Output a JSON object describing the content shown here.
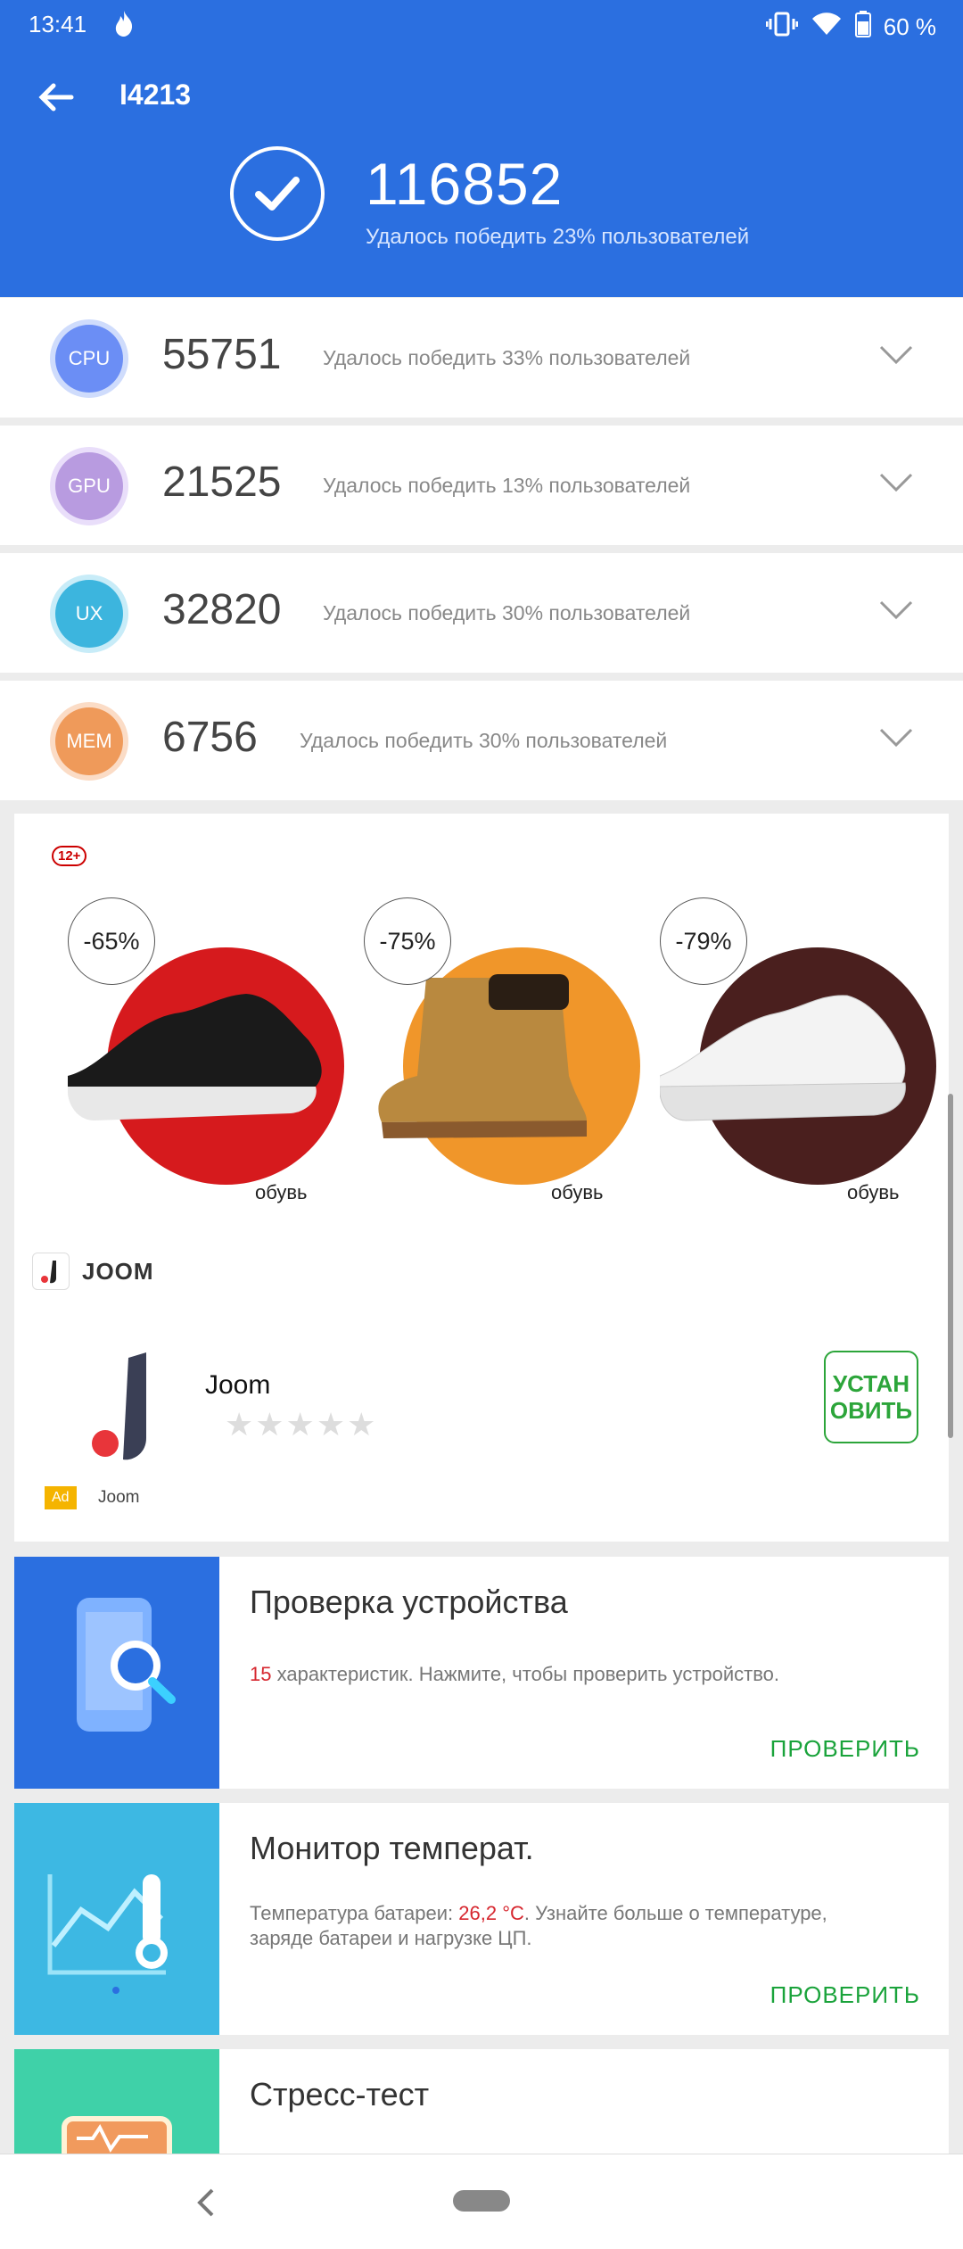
{
  "status": {
    "time": "13:41",
    "battery": "60 %"
  },
  "header": {
    "title": "I4213",
    "total_score": "116852",
    "total_beat": "Удалось победить 23% пользователей"
  },
  "results": [
    {
      "label": "CPU",
      "score": "55751",
      "beat": "Удалось победить 33% пользователей",
      "color": "#6b8ef5"
    },
    {
      "label": "GPU",
      "score": "21525",
      "beat": "Удалось победить 13% пользователей",
      "color": "#b89be0"
    },
    {
      "label": "UX",
      "score": "32820",
      "beat": "Удалось победить 30% пользователей",
      "color": "#3cb5de"
    },
    {
      "label": "MEM",
      "score": "6756",
      "beat": "Удалось победить 30% пользователей",
      "color": "#ef9a5a"
    }
  ],
  "ad": {
    "age_rating": "12+",
    "products": [
      {
        "discount": "-65%",
        "label": "обувь",
        "color": "#d61a1d"
      },
      {
        "discount": "-75%",
        "label": "обувь",
        "color": "#f0962a"
      },
      {
        "discount": "-79%",
        "label": "обувь",
        "color": "#4a1f1e"
      }
    ],
    "brand": "JOOM",
    "app_name": "Joom",
    "install_label": "УСТАН ОВИТЬ",
    "badge": "Ad",
    "source": "Joom"
  },
  "cards": [
    {
      "title": "Проверка устройства",
      "desc_count": "15",
      "desc_text": " характеристик. Нажмите, чтобы проверить устройство.",
      "button": "ПРОВЕРИТЬ",
      "color": "#2b6fe0"
    },
    {
      "title": "Монитор температ.",
      "desc_prefix": "Температура батареи: ",
      "desc_temp": "26,2 °C",
      "desc_suffix": ". Узнайте больше о температуре, заряде батареи и нагрузке ЦП.",
      "button": "ПРОВЕРИТЬ",
      "color": "#3db8e3"
    },
    {
      "title": "Стресс-тест",
      "color": "#3fd1a8"
    }
  ]
}
